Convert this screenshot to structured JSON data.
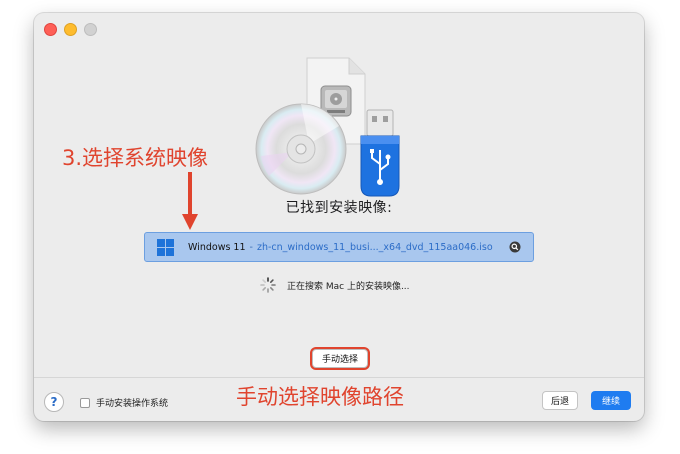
{
  "window": {
    "found_title": "已找到安装映像:",
    "image": {
      "os_name": "Windows 11",
      "separator": "-",
      "file_name": "zh-cn_windows_11_busi..._x64_dvd_115aa046.iso"
    },
    "searching_text": "正在搜索 Mac 上的安装映像...",
    "manual_select_label": "手动选择",
    "checkbox_label": "手动安装操作系统",
    "help_label": "?",
    "back_label": "后退",
    "continue_label": "继续"
  },
  "annotations": {
    "step_text": "3.选择系统映像",
    "manual_path_text": "手动选择映像路径",
    "color": "#e0442e"
  },
  "colors": {
    "accent": "#1f7cf0",
    "selection": "#a9c7ee",
    "window_bg": "#ececec"
  },
  "icons": [
    "dvd-disc-icon",
    "disk-image-document-icon",
    "usb-drive-icon",
    "windows-logo-icon",
    "magnifier-reveal-icon",
    "spinner-icon"
  ]
}
